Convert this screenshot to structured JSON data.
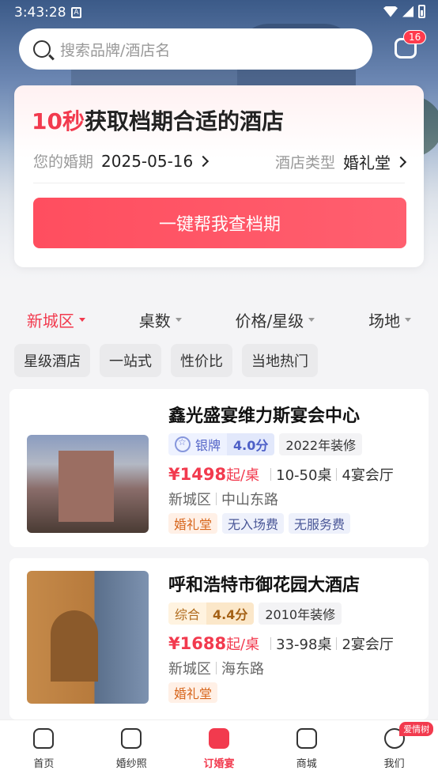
{
  "status_bar": {
    "time": "3:43:28"
  },
  "search": {
    "placeholder": "搜索品牌/酒店名"
  },
  "messages": {
    "badge": "16"
  },
  "promo": {
    "title_highlight": "10秒",
    "title_rest": "获取档期合适的酒店",
    "date_label": "您的婚期",
    "date_value": "2025-05-16",
    "type_label": "酒店类型",
    "type_value": "婚礼堂",
    "cta": "一键帮我查档期"
  },
  "filters": [
    {
      "label": "新城区",
      "active": true
    },
    {
      "label": "桌数"
    },
    {
      "label": "价格/星级"
    },
    {
      "label": "场地"
    }
  ],
  "chips": [
    "星级酒店",
    "一站式",
    "性价比",
    "当地热门"
  ],
  "hotels": [
    {
      "name": "鑫光盛宴维力斯宴会中心",
      "rank_label": "银牌",
      "score": "4.0分",
      "renovation": "2022年装修",
      "price": "¥1498",
      "price_unit": "起/桌",
      "tables": "10-50桌",
      "halls": "4宴会厅",
      "district": "新城区",
      "road": "中山东路",
      "tags": [
        "婚礼堂",
        "无入场费",
        "无服务费"
      ]
    },
    {
      "name": "呼和浩特市御花园大酒店",
      "rank_label": "综合",
      "score": "4.4分",
      "renovation": "2010年装修",
      "price": "¥1688",
      "price_unit": "起/桌",
      "tables": "33-98桌",
      "halls": "2宴会厅",
      "district": "新城区",
      "road": "海东路",
      "tags": [
        "婚礼堂"
      ]
    }
  ],
  "tabbar": [
    {
      "label": "首页"
    },
    {
      "label": "婚纱照"
    },
    {
      "label": "订婚宴",
      "active": true
    },
    {
      "label": "商城"
    },
    {
      "label": "我们",
      "badge": "爱情树"
    }
  ]
}
